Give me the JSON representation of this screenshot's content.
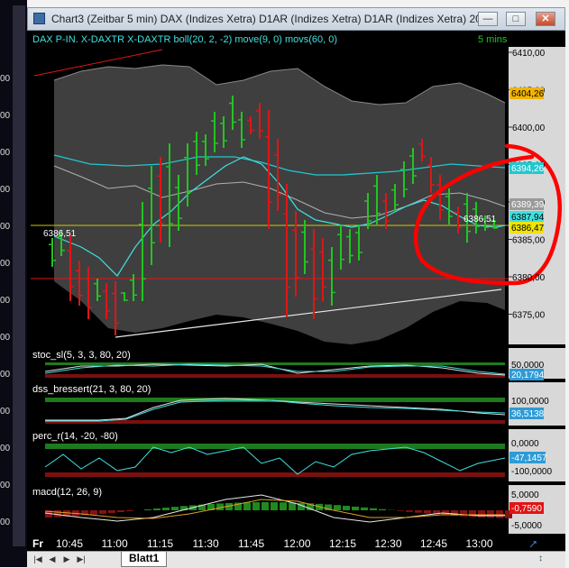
{
  "window": {
    "title": "Chart3 (Zeitbar 5 min)  DAX (Indizes Xetra) D1AR (Indizes Xetra) D1AR (Indizes Xetra) 20...",
    "minimize": "—",
    "maximize": "□",
    "close": "✕"
  },
  "left_strip": {
    "labels": [
      "00",
      "00",
      "00",
      "00",
      "00",
      "00",
      "00",
      "00",
      "00",
      "00",
      "00",
      "00",
      "00"
    ]
  },
  "main_panel": {
    "header": "DAX P-IN. X-DAXTR X-DAXTR boll(20, 2, -2) move(9, 0) movs(60, 0)",
    "interval": "5 mins",
    "price_scale": [
      "6410,00",
      "6405,00",
      "6400,00",
      "6395,00",
      "6390,00",
      "6385,00",
      "6380,00",
      "6375,00"
    ],
    "tags": {
      "upper_band": "6404,26",
      "move60": "6394,26",
      "lower_gray": "6389,39",
      "move9": "6387,94",
      "last": "6386,47"
    },
    "price_line_label_left": "6386,51",
    "price_line_label_right": "6386,51",
    "colors": {
      "up": "#22c422",
      "down": "#e01515",
      "move9": "#40e0e0",
      "move60": "#20c8d0",
      "annotation": "#ff0000"
    }
  },
  "panels": [
    {
      "name": "stoc_sl",
      "label": "stoc_sl(5, 3, 3, 80, 20)",
      "scale_top": "50,0000",
      "value_tag": "20,1794",
      "tag_color": "#2e9bd6"
    },
    {
      "name": "dss_bressert",
      "label": "dss_bressert(21, 3, 80, 20)",
      "scale_top": "100,0000",
      "value_tag": "36,5138",
      "tag_color": "#2e9bd6"
    },
    {
      "name": "perc_r",
      "label": "perc_r(14, -20, -80)",
      "scale_top": "0,0000",
      "value_tag": "-47,1457",
      "scale_bottom": "-100,0000",
      "tag_color": "#2e9bd6"
    },
    {
      "name": "macd",
      "label": "macd(12, 26, 9)",
      "scale_top": "5,0000",
      "value_tag": "-0,7590",
      "scale_bottom": "-5,0000",
      "tag_color": "#e01515"
    }
  ],
  "time_axis": {
    "day": "Fr",
    "labels": [
      "10:45",
      "11:00",
      "11:15",
      "11:30",
      "11:45",
      "12:00",
      "12:15",
      "12:30",
      "12:45",
      "13:00"
    ]
  },
  "tabs": {
    "sheet": "Blatt1",
    "nav": [
      "|◀",
      "◀",
      "▶",
      "▶|"
    ]
  }
}
